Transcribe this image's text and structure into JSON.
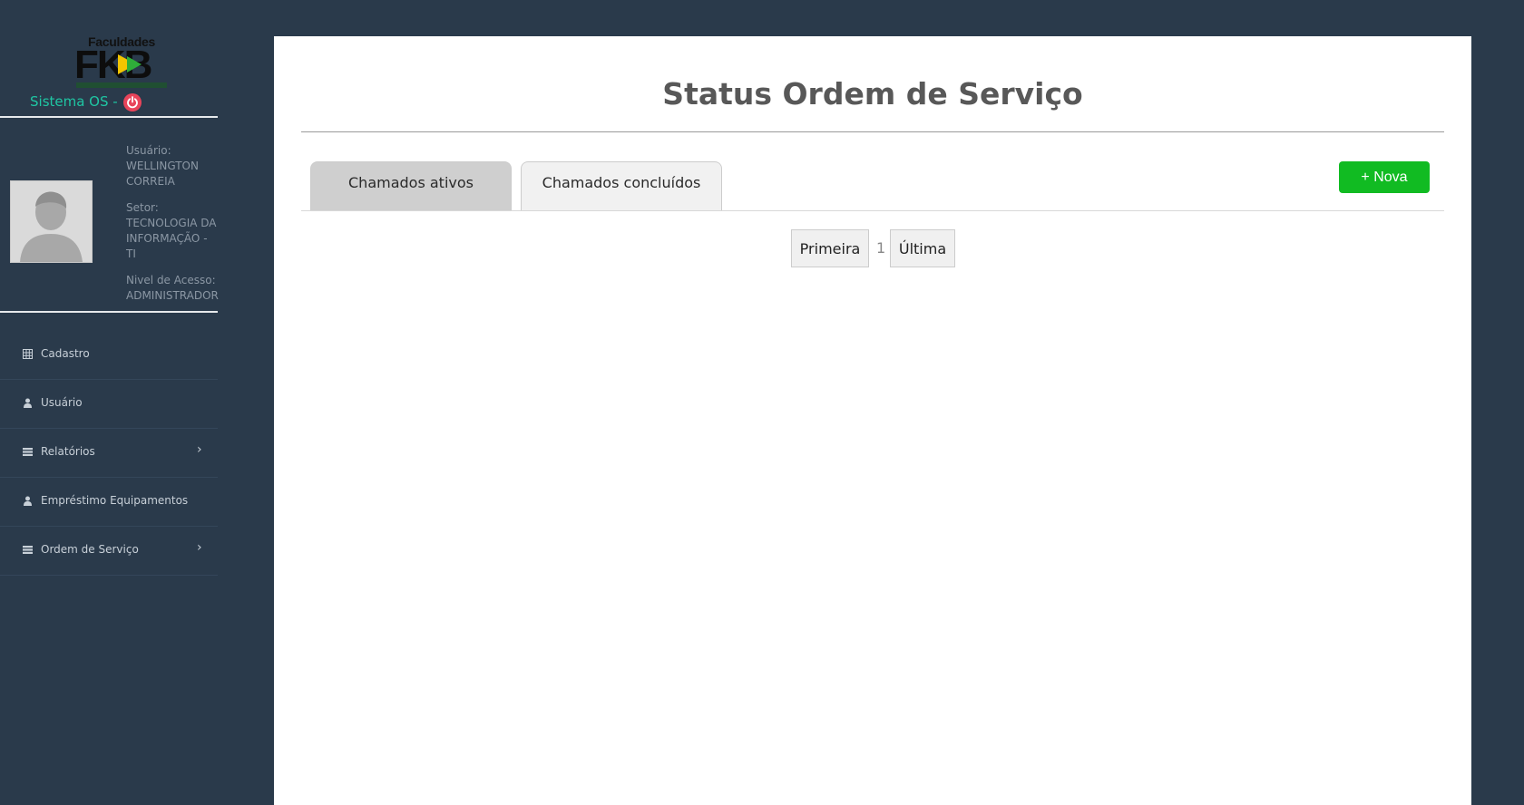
{
  "sidebar": {
    "logo_top": "Faculdades",
    "logo_big": "FKB",
    "system_title": "Sistema OS -",
    "user": {
      "user_label": "Usuário:",
      "user_value": "WELLINGTON CORREIA",
      "sector_label": "Setor:",
      "sector_value": "TECNOLOGIA DA INFORMAÇÃO - TI",
      "access_label": "Nivel de Acesso:",
      "access_value": "ADMINISTRADOR"
    },
    "menu": [
      {
        "label": "Cadastro",
        "icon": "table-icon",
        "has_submenu": false
      },
      {
        "label": "Usuário",
        "icon": "user-icon",
        "has_submenu": false
      },
      {
        "label": "Relatórios",
        "icon": "list-icon",
        "has_submenu": true
      },
      {
        "label": "Empréstimo Equipamentos",
        "icon": "user-icon",
        "has_submenu": false
      },
      {
        "label": "Ordem de Serviço",
        "icon": "list-icon",
        "has_submenu": true
      }
    ]
  },
  "main": {
    "title": "Status Ordem de Serviço",
    "tabs": [
      {
        "label": "Chamados ativos",
        "active": true
      },
      {
        "label": "Chamados concluídos",
        "active": false
      }
    ],
    "new_button": "+ Nova",
    "pagination": {
      "first": "Primeira",
      "current_page": "1",
      "last": "Última"
    }
  },
  "colors": {
    "background": "#2a3a4b",
    "accent_teal": "#1fc6a3",
    "power_red": "#e8445a",
    "new_button_green": "#11bb22"
  }
}
